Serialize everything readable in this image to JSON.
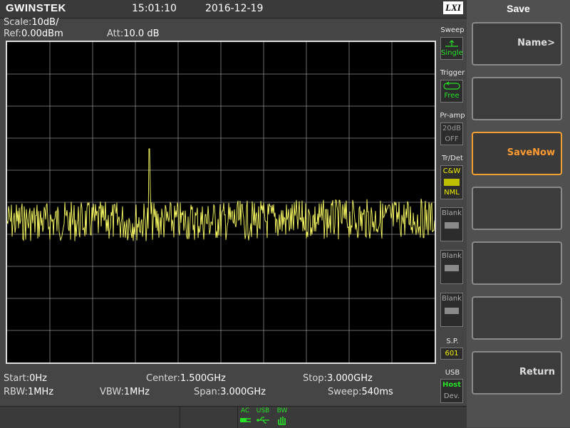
{
  "header": {
    "brand": "GWINSTEK",
    "time": "15:01:10",
    "date": "2016-12-19",
    "lxi": "LXI"
  },
  "display": {
    "scale_label": "Scale:",
    "scale_value": "10dB/",
    "ref_label": "Ref:",
    "ref_value": "0.00dBm",
    "att_label": "Att:",
    "att_value": "10.0 dB"
  },
  "footer": {
    "start_label": "Start:",
    "start_value": "0Hz",
    "center_label": "Center:",
    "center_value": "1.500GHz",
    "stop_label": "Stop:",
    "stop_value": "3.000GHz",
    "rbw_label": "RBW:",
    "rbw_value": "1MHz",
    "vbw_label": "VBW:",
    "vbw_value": "1MHz",
    "span_label": "Span:",
    "span_value": "3.000GHz",
    "sweep_label": "Sweep:",
    "sweep_value": "540ms"
  },
  "side_panel": {
    "sweep_label": "Sweep",
    "sweep_mode": "Single",
    "trigger_label": "Trigger",
    "trigger_mode": "Free",
    "preamp_label": "Pr-amp",
    "preamp_gain": "20dB",
    "preamp_state": "OFF",
    "trdet_label": "Tr/Det",
    "trdet_mode": "C&W",
    "trdet_det": "NML",
    "blank_label": "Blank",
    "sp_label": "S.P.",
    "sp_value": "601",
    "usb_label": "USB",
    "usb_host": "Host",
    "usb_dev": "Dev."
  },
  "softkeys": {
    "title": "Save",
    "keys": [
      "Name>",
      "",
      "SaveNow",
      "",
      "",
      "",
      "Return"
    ]
  },
  "status_indicators": {
    "ac": "AC",
    "usb": "USB",
    "bw": "BW"
  },
  "colors": {
    "trace": "#ffff66",
    "grid": "#8a8a8a",
    "active_key": "#f0a030",
    "indicator": "#28e028"
  }
}
